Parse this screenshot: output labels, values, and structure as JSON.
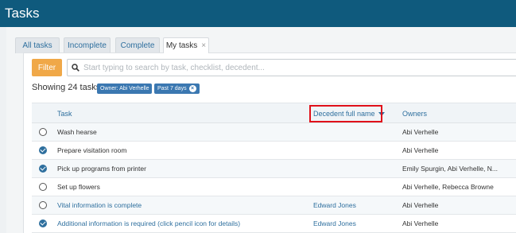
{
  "app": {
    "title": "Tasks"
  },
  "tabs": [
    {
      "label": "All tasks"
    },
    {
      "label": "Incomplete"
    },
    {
      "label": "Complete"
    },
    {
      "label": "My tasks",
      "close": "×"
    }
  ],
  "toolbar": {
    "filter_label": "Filter",
    "search_placeholder": "Start typing to search by task, checklist, decedent..."
  },
  "summary": {
    "showing": "Showing 24 tasks",
    "chips": [
      {
        "label": "Owner: Abi Verhelle"
      },
      {
        "label": "Past 7 days"
      }
    ]
  },
  "table": {
    "headers": {
      "task": "Task",
      "decedent": "Decedent full name",
      "owners": "Owners"
    },
    "rows": [
      {
        "task": "Wash hearse",
        "decedent": "",
        "owners": "Abi Verhelle",
        "status": "open"
      },
      {
        "task": "Prepare visitation room",
        "decedent": "",
        "owners": "Abi Verhelle",
        "status": "done"
      },
      {
        "task": "Pick up programs from printer",
        "decedent": "",
        "owners": "Emily Spurgin, Abi Verhelle, N...",
        "status": "done"
      },
      {
        "task": "Set up flowers",
        "decedent": "",
        "owners": "Abi Verhelle, Rebecca Browne",
        "status": "open"
      },
      {
        "task": "Vital information is complete",
        "decedent": "Edward Jones",
        "owners": "Abi Verhelle",
        "status": "open"
      },
      {
        "task": "Additional information is required (click pencil icon for details)",
        "decedent": "Edward Jones",
        "owners": "Abi Verhelle",
        "status": "done"
      }
    ]
  },
  "colors": {
    "header_bg": "#0f5a7d",
    "accent": "#2e6f9e",
    "filter": "#f0a848",
    "highlight_box": "#e0101a"
  }
}
